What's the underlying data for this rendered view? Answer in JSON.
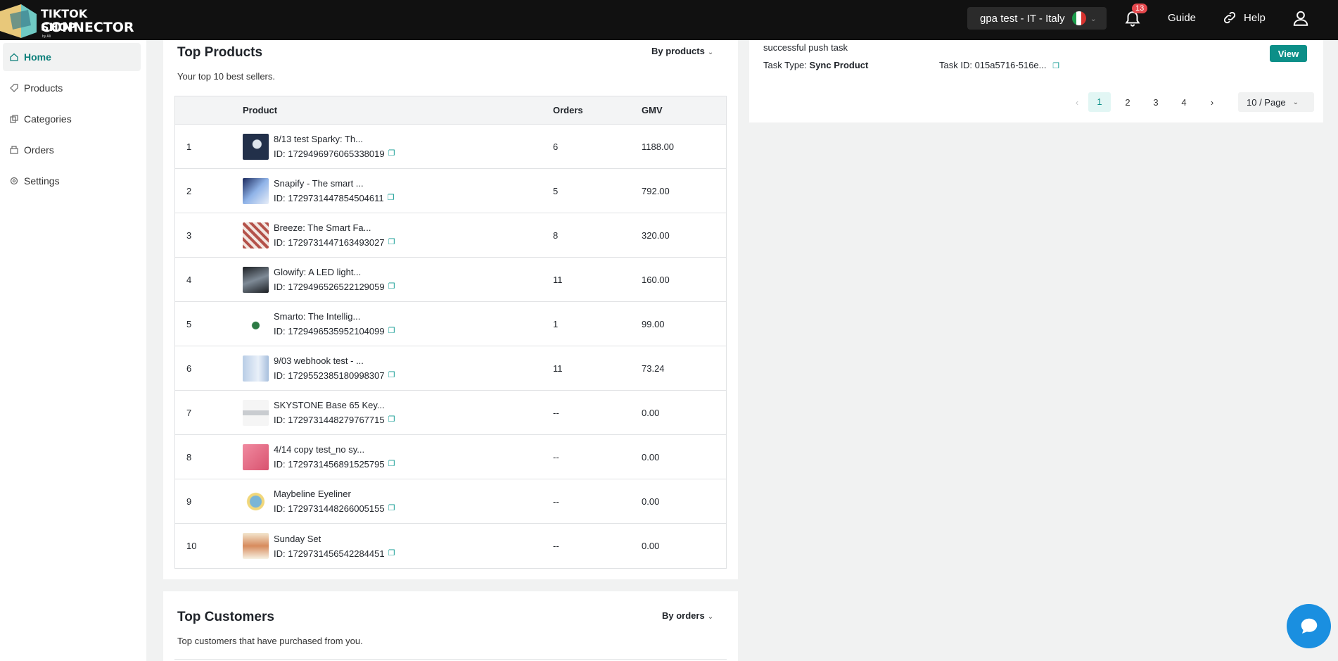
{
  "brand": {
    "line1": "TIKTOK SHOP",
    "line2": "CONNECTOR",
    "line3": "by Ali"
  },
  "header": {
    "store_label": "gpa test - IT  -  Italy",
    "notification_count": "13",
    "guide_label": "Guide",
    "help_label": "Help"
  },
  "sidebar": {
    "items": [
      {
        "label": "Home",
        "icon": "home-icon",
        "active": true
      },
      {
        "label": "Products",
        "icon": "tag-icon",
        "active": false
      },
      {
        "label": "Categories",
        "icon": "categories-icon",
        "active": false
      },
      {
        "label": "Orders",
        "icon": "orders-icon",
        "active": false
      },
      {
        "label": "Settings",
        "icon": "gear-icon",
        "active": false
      }
    ]
  },
  "top_products": {
    "title": "Top Products",
    "subtitle": "Your top 10 best sellers.",
    "sort_label": "By products",
    "columns": [
      "Product",
      "Orders",
      "GMV"
    ],
    "rows": [
      {
        "rank": "1",
        "name": "8/13 test Sparky: Th...",
        "id": "ID: 1729496976065338019",
        "orders": "6",
        "gmv": "1188.00"
      },
      {
        "rank": "2",
        "name": "Snapify - The smart ...",
        "id": "ID: 1729731447854504611",
        "orders": "5",
        "gmv": "792.00"
      },
      {
        "rank": "3",
        "name": "Breeze: The Smart Fa...",
        "id": "ID: 1729731447163493027",
        "orders": "8",
        "gmv": "320.00"
      },
      {
        "rank": "4",
        "name": "Glowify: A LED light...",
        "id": "ID: 1729496526522129059",
        "orders": "11",
        "gmv": "160.00"
      },
      {
        "rank": "5",
        "name": "Smarto: The Intellig...",
        "id": "ID: 1729496535952104099",
        "orders": "1",
        "gmv": "99.00"
      },
      {
        "rank": "6",
        "name": "9/03 webhook test - ...",
        "id": "ID: 1729552385180998307",
        "orders": "11",
        "gmv": "73.24"
      },
      {
        "rank": "7",
        "name": "SKYSTONE Base 65 Key...",
        "id": "ID: 1729731448279767715",
        "orders": "--",
        "gmv": "0.00"
      },
      {
        "rank": "8",
        "name": "4/14 copy test_no sy...",
        "id": "ID: 1729731456891525795",
        "orders": "--",
        "gmv": "0.00"
      },
      {
        "rank": "9",
        "name": "Maybeline Eyeliner",
        "id": "ID: 1729731448266005155",
        "orders": "--",
        "gmv": "0.00"
      },
      {
        "rank": "10",
        "name": "Sunday Set",
        "id": "ID: 1729731456542284451",
        "orders": "--",
        "gmv": "0.00"
      }
    ]
  },
  "top_customers": {
    "title": "Top Customers",
    "subtitle": "Top customers that have purchased from you.",
    "sort_label": "By orders"
  },
  "task": {
    "message": "successful push task",
    "type_label": "Task Type:",
    "type_value": "Sync Product",
    "id_label": "Task ID: 015a5716-516e...",
    "view_label": "View"
  },
  "pagination": {
    "pages": [
      "1",
      "2",
      "3",
      "4"
    ],
    "current": "1",
    "per_page": "10  / Page"
  },
  "colors": {
    "accent": "#0c8f88",
    "topbar": "#111111",
    "badge": "#e5484d",
    "chat": "#1a8fe0"
  }
}
